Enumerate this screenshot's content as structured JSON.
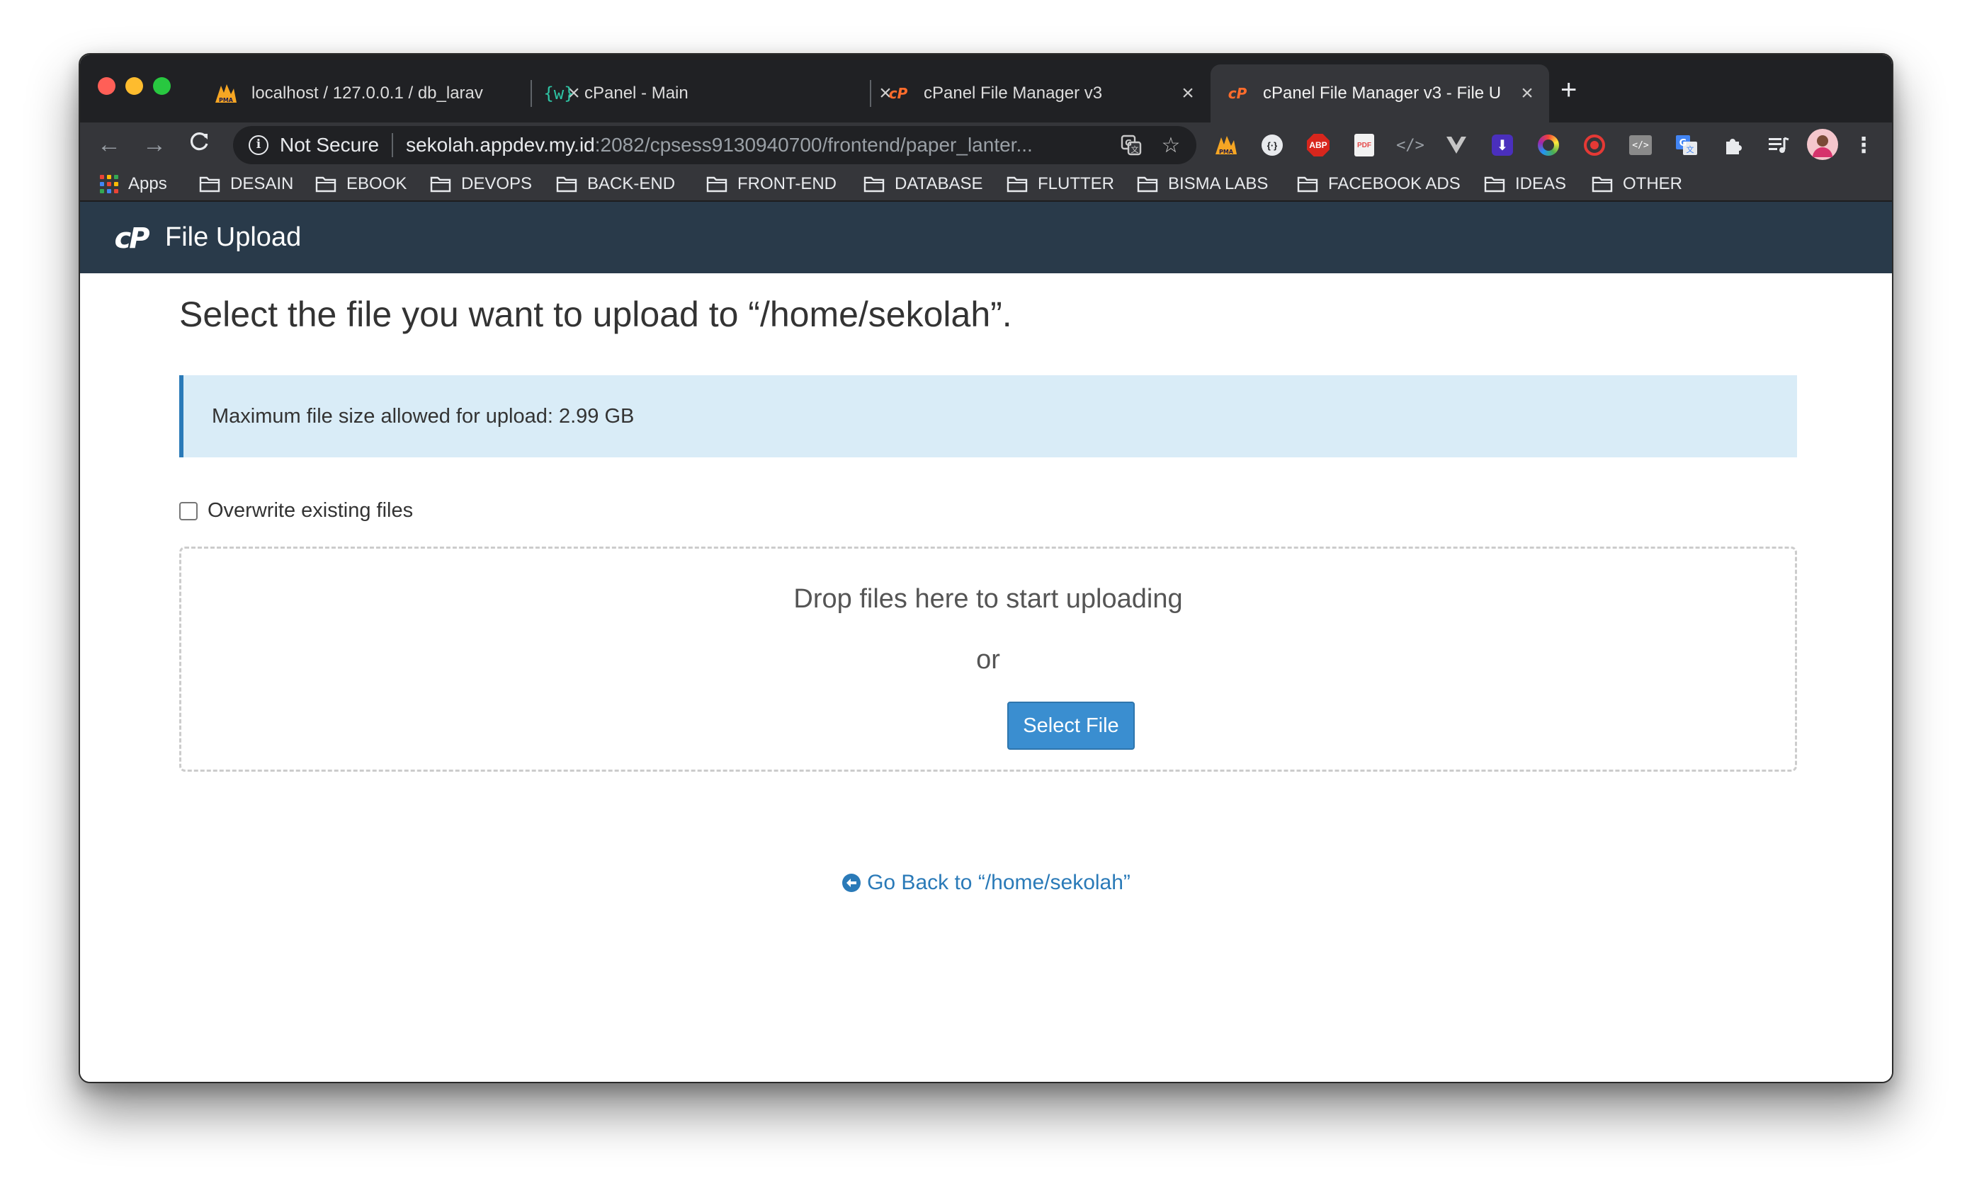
{
  "tabs": [
    {
      "title": "localhost / 127.0.0.1 / db_larav",
      "icon": "phpmyadmin-icon",
      "active": false
    },
    {
      "title": "cPanel - Main",
      "icon": "wordpress-toolkit-icon",
      "active": false
    },
    {
      "title": "cPanel File Manager v3",
      "icon": "cpanel-icon",
      "active": false
    },
    {
      "title": "cPanel File Manager v3 - File U",
      "icon": "cpanel-icon",
      "active": true
    }
  ],
  "toolbar": {
    "security_label": "Not Secure",
    "url_host": "sekolah.appdev.my.id",
    "url_path": ":2082/cpsess9130940700/frontend/paper_lanter..."
  },
  "bookmarks": {
    "apps_label": "Apps",
    "folders": [
      "DESAIN",
      "EBOOK",
      "DEVOPS",
      "BACK-END",
      "FRONT-END",
      "DATABASE",
      "FLUTTER",
      "BISMA LABS",
      "FACEBOOK ADS",
      "IDEAS",
      "OTHER"
    ]
  },
  "extensions": [
    {
      "name": "pma-extension-icon",
      "glyph": "▲",
      "color": "#f6a623"
    },
    {
      "name": "json-extension-icon",
      "glyph": "{·}",
      "color": "#ffffff"
    },
    {
      "name": "adblock-plus-icon",
      "glyph": "ABP",
      "color": "#d8261d"
    },
    {
      "name": "pdf-extension-icon",
      "glyph": "PDF",
      "color": "#e54b4b"
    },
    {
      "name": "code-extension-icon",
      "glyph": "</>",
      "color": "#9aa0a6"
    },
    {
      "name": "vue-devtools-icon",
      "glyph": "V",
      "color": "#c5c5c5"
    },
    {
      "name": "download-extension-icon",
      "glyph": "⬇",
      "color": "#6b4de6"
    },
    {
      "name": "color-picker-icon",
      "glyph": "◉",
      "color": "#42a5f5"
    },
    {
      "name": "target-extension-icon",
      "glyph": "◎",
      "color": "#e53935"
    },
    {
      "name": "source-view-icon",
      "glyph": "</>",
      "color": "#aaaaaa"
    },
    {
      "name": "google-translate-icon",
      "glyph": "G",
      "color": "#4285f4"
    },
    {
      "name": "extensions-puzzle-icon",
      "glyph": "✚",
      "color": "#e8eaed"
    },
    {
      "name": "media-control-icon",
      "glyph": "≡",
      "color": "#e8eaed"
    }
  ],
  "header": {
    "title": "File Upload"
  },
  "main": {
    "headline": "Select the file you want to upload to “/home/sekolah”.",
    "max_size_notice": "Maximum file size allowed for upload: 2.99 GB",
    "overwrite_label": "Overwrite existing files",
    "dropzone_text": "Drop files here to start uploading",
    "or_text": "or",
    "select_button": "Select File",
    "go_back": "Go Back to “/home/sekolah”"
  },
  "colors": {
    "header_bg": "#293a4a",
    "alert_bg": "#d9ecf7",
    "accent_blue": "#3a8ed0",
    "link_blue": "#2a7ab8",
    "cpanel_orange": "#ff6c2c"
  }
}
